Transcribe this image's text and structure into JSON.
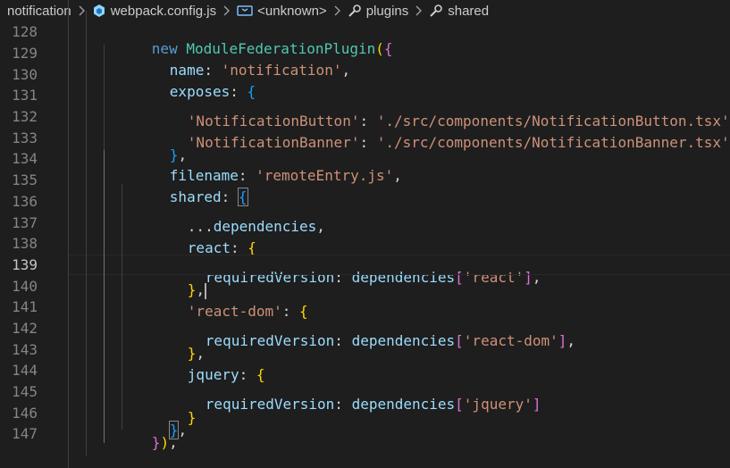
{
  "breadcrumb": {
    "items": [
      {
        "label": "notification",
        "icon": "folder"
      },
      {
        "label": "webpack.config.js",
        "icon": "webpack-icon"
      },
      {
        "label": "<unknown>",
        "icon": "symbol-variable-icon"
      },
      {
        "label": "plugins",
        "icon": "wrench-icon"
      },
      {
        "label": "shared",
        "icon": "wrench-icon"
      }
    ]
  },
  "editor": {
    "lines": [
      {
        "n": "128"
      },
      {
        "n": "129"
      },
      {
        "n": "130"
      },
      {
        "n": "131"
      },
      {
        "n": "132"
      },
      {
        "n": "133"
      },
      {
        "n": "134"
      },
      {
        "n": "135"
      },
      {
        "n": "136"
      },
      {
        "n": "137"
      },
      {
        "n": "138"
      },
      {
        "n": "139"
      },
      {
        "n": "140"
      },
      {
        "n": "141"
      },
      {
        "n": "142"
      },
      {
        "n": "143"
      },
      {
        "n": "144"
      },
      {
        "n": "145"
      },
      {
        "n": "146"
      },
      {
        "n": "147"
      }
    ],
    "tokens": {
      "t128": [
        "new",
        "ModuleFederationPlugin",
        "(",
        "{"
      ],
      "t129": [
        "name",
        ": ",
        "'notification'",
        ","
      ],
      "t130": [
        "exposes",
        ": ",
        "{"
      ],
      "t131": [
        "'NotificationButton'",
        ": ",
        "'./src/components/NotificationButton.tsx'",
        ","
      ],
      "t132": [
        "'NotificationBanner'",
        ": ",
        "'./src/components/NotificationBanner.tsx'",
        ","
      ],
      "t133": [
        "}",
        ","
      ],
      "t134": [
        "filename",
        ": ",
        "'remoteEntry.js'",
        ","
      ],
      "t135": [
        "shared",
        ": ",
        "{"
      ],
      "t136": [
        "...",
        "dependencies",
        ","
      ],
      "t137": [
        "react",
        ": ",
        "{"
      ],
      "t138": [
        "requiredVersion",
        ": ",
        "dependencies",
        "[",
        "'react'",
        "]",
        ","
      ],
      "t139": [
        "}",
        ","
      ],
      "t140": [
        "'react-dom'",
        ": ",
        "{"
      ],
      "t141": [
        "requiredVersion",
        ": ",
        "dependencies",
        "[",
        "'react-dom'",
        "]",
        ","
      ],
      "t142": [
        "}",
        ","
      ],
      "t143": [
        "jquery",
        ": ",
        "{"
      ],
      "t144": [
        "requiredVersion",
        ": ",
        "dependencies",
        "[",
        "'jquery'",
        "]"
      ],
      "t145": [
        "}"
      ],
      "t146": [
        "}",
        ","
      ],
      "t147": [
        "}",
        ")",
        ","
      ]
    },
    "active_line": "139",
    "colors": {
      "background": "#1e1e1e",
      "keyword": "#569cd6",
      "class": "#4ec9b0",
      "property": "#9cdcfe",
      "string": "#ce9178",
      "bracket_level1": "#ffd700",
      "bracket_level2": "#da70d6",
      "bracket_level3": "#179fff"
    }
  }
}
